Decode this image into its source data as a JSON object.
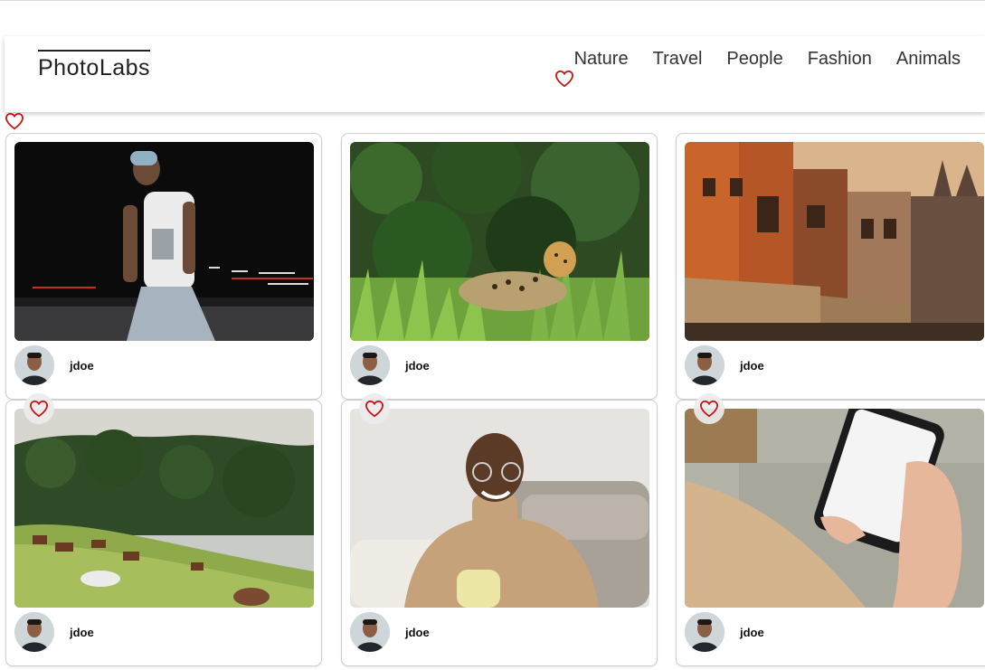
{
  "app": {
    "brand": "PhotoLabs"
  },
  "nav": {
    "topics": [
      {
        "label": "Nature"
      },
      {
        "label": "Travel"
      },
      {
        "label": "People"
      },
      {
        "label": "Fashion"
      },
      {
        "label": "Animals"
      }
    ],
    "fav_icon": "heart-outline-icon"
  },
  "colors": {
    "heart": "#c41818",
    "text": "#222222",
    "card_border": "#cfcfcf"
  },
  "photos": [
    {
      "username": "jdoe",
      "subject": "man walking at night street",
      "favorited": false
    },
    {
      "username": "jdoe",
      "subject": "jaguar in grass",
      "favorited": false
    },
    {
      "username": "jdoe",
      "subject": "old city buildings",
      "favorited": false
    },
    {
      "username": "jdoe",
      "subject": "horses on hillside",
      "favorited": false
    },
    {
      "username": "jdoe",
      "subject": "smiling man with mug",
      "favorited": false
    },
    {
      "username": "jdoe",
      "subject": "hand holding phone",
      "favorited": false
    }
  ]
}
